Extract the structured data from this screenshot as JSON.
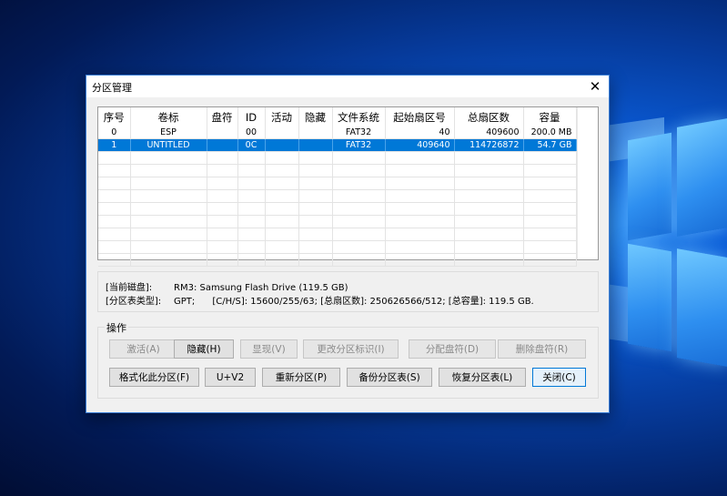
{
  "window": {
    "title": "分区管理"
  },
  "grid": {
    "columns": [
      "序号",
      "卷标",
      "盘符",
      "ID",
      "活动",
      "隐藏",
      "文件系统",
      "起始扇区号",
      "总扇区数",
      "容量"
    ],
    "rows": [
      [
        "0",
        "ESP",
        "",
        "00",
        "",
        "",
        "FAT32",
        "40",
        "409600",
        "200.0 MB"
      ],
      [
        "1",
        "UNTITLED",
        "",
        "0C",
        "",
        "",
        "FAT32",
        "409640",
        "114726872",
        "54.7 GB"
      ]
    ],
    "selected_row": 1
  },
  "info": {
    "disk_label": "[当前磁盘]:",
    "disk_value": "RM3: Samsung Flash Drive (119.5 GB)",
    "table_label": "[分区表类型]:",
    "table_value": "GPT;      [C/H/S]: 15600/255/63; [总扇区数]: 250626566/512; [总容量]: 119.5 GB."
  },
  "ops": {
    "title": "操作",
    "activate": "激活(A)",
    "hide": "隐藏(H)",
    "show": "显现(V)",
    "change_id": "更改分区标识(I)",
    "assign_letter": "分配盘符(D)",
    "remove_letter": "删除盘符(R)",
    "format": "格式化此分区(F)",
    "uplusv2": "U+V2",
    "repartition": "重新分区(P)",
    "backup": "备份分区表(S)",
    "restore": "恢复分区表(L)",
    "close": "关闭(C)"
  }
}
